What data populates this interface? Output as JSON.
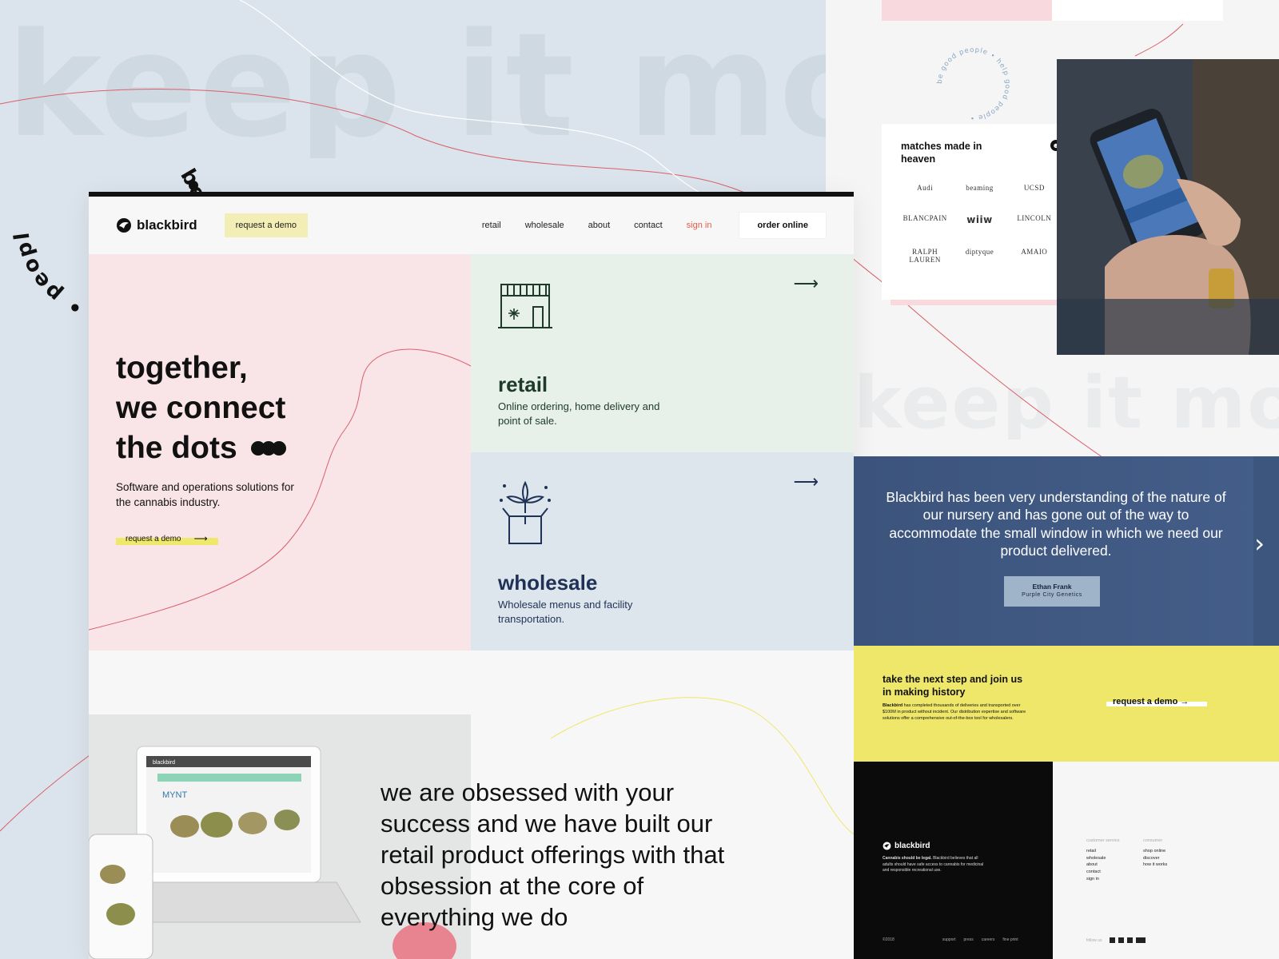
{
  "backdrop": {
    "watermark_top": "keep it movi",
    "watermark_right": "keep it mov",
    "ring_big_text": "be good people • people",
    "ring_small_text": "be good people • help good people •"
  },
  "nav": {
    "brand": "blackbird",
    "request_demo": "request a demo",
    "links": [
      "retail",
      "wholesale",
      "about",
      "contact"
    ],
    "sign_in": "sign in",
    "order_online": "order online"
  },
  "hero": {
    "title_line1": "together,",
    "title_line2": "we connect",
    "title_line3": "the dots",
    "subtitle": "Software and operations solutions for the cannabis industry.",
    "cta": "request a demo",
    "cta_arrow": "⟶"
  },
  "cards": {
    "retail": {
      "title": "retail",
      "desc": "Online ordering, home delivery and point of sale.",
      "arrow": "⟶",
      "icon": "storefront-icon"
    },
    "wholesale": {
      "title": "wholesale",
      "desc": "Wholesale menus and facility transportation.",
      "arrow": "⟶",
      "icon": "box-leaf-icon"
    }
  },
  "lower": {
    "statement": "we are obsessed with your success and we have built our retail product offerings with that obsession at the core of everything we do",
    "laptop_brand": "blackbird",
    "laptop_product": "MYNT"
  },
  "matches": {
    "title": "matches made in heaven",
    "brands": [
      "Audi",
      "beaming",
      "UCSD",
      "BLANCPAIN",
      "wiiw",
      "LINCOLN",
      "RALPH LAUREN",
      "diptyque",
      "AMAIO"
    ]
  },
  "testimonial": {
    "quote": "Blackbird has been very understanding of the nature of our nursery and has gone out of the way to accommodate the small window in which we need our product delivered.",
    "author": "Ethan Frank",
    "company": "Purple City Genetics",
    "next": "›"
  },
  "next_step": {
    "title": "take the next step and join us in making history",
    "body_lead": "Blackbird",
    "body": "has completed thousands of deliveries and transported over $100M in product without incident. Our distribution expertise and software solutions offer a comprehensive out-of-the-box tool for wholesalers.",
    "cta": "request a demo →"
  },
  "footer": {
    "brand": "blackbird",
    "tagline_lead": "Cannabis should be legal.",
    "tagline": "Blackbird believes that all adults should have safe access to cannabis for medicinal and responsible recreational use.",
    "copyright": "©2018",
    "bottom_links": [
      "support",
      "press",
      "careers",
      "fine print"
    ],
    "col1_head": "customer service",
    "col1": [
      "retail",
      "wholesale",
      "about",
      "contact",
      "sign in"
    ],
    "col2_head": "consumer",
    "col2": [
      "shop online",
      "discover",
      "how it works"
    ],
    "follow": "follow us"
  },
  "colors": {
    "pink": "#f9e4e7",
    "mint": "#e7f0e9",
    "blue": "#dde5ed",
    "yellow": "#eee769",
    "navy": "#3d567d",
    "accent": "#e65a4a"
  }
}
